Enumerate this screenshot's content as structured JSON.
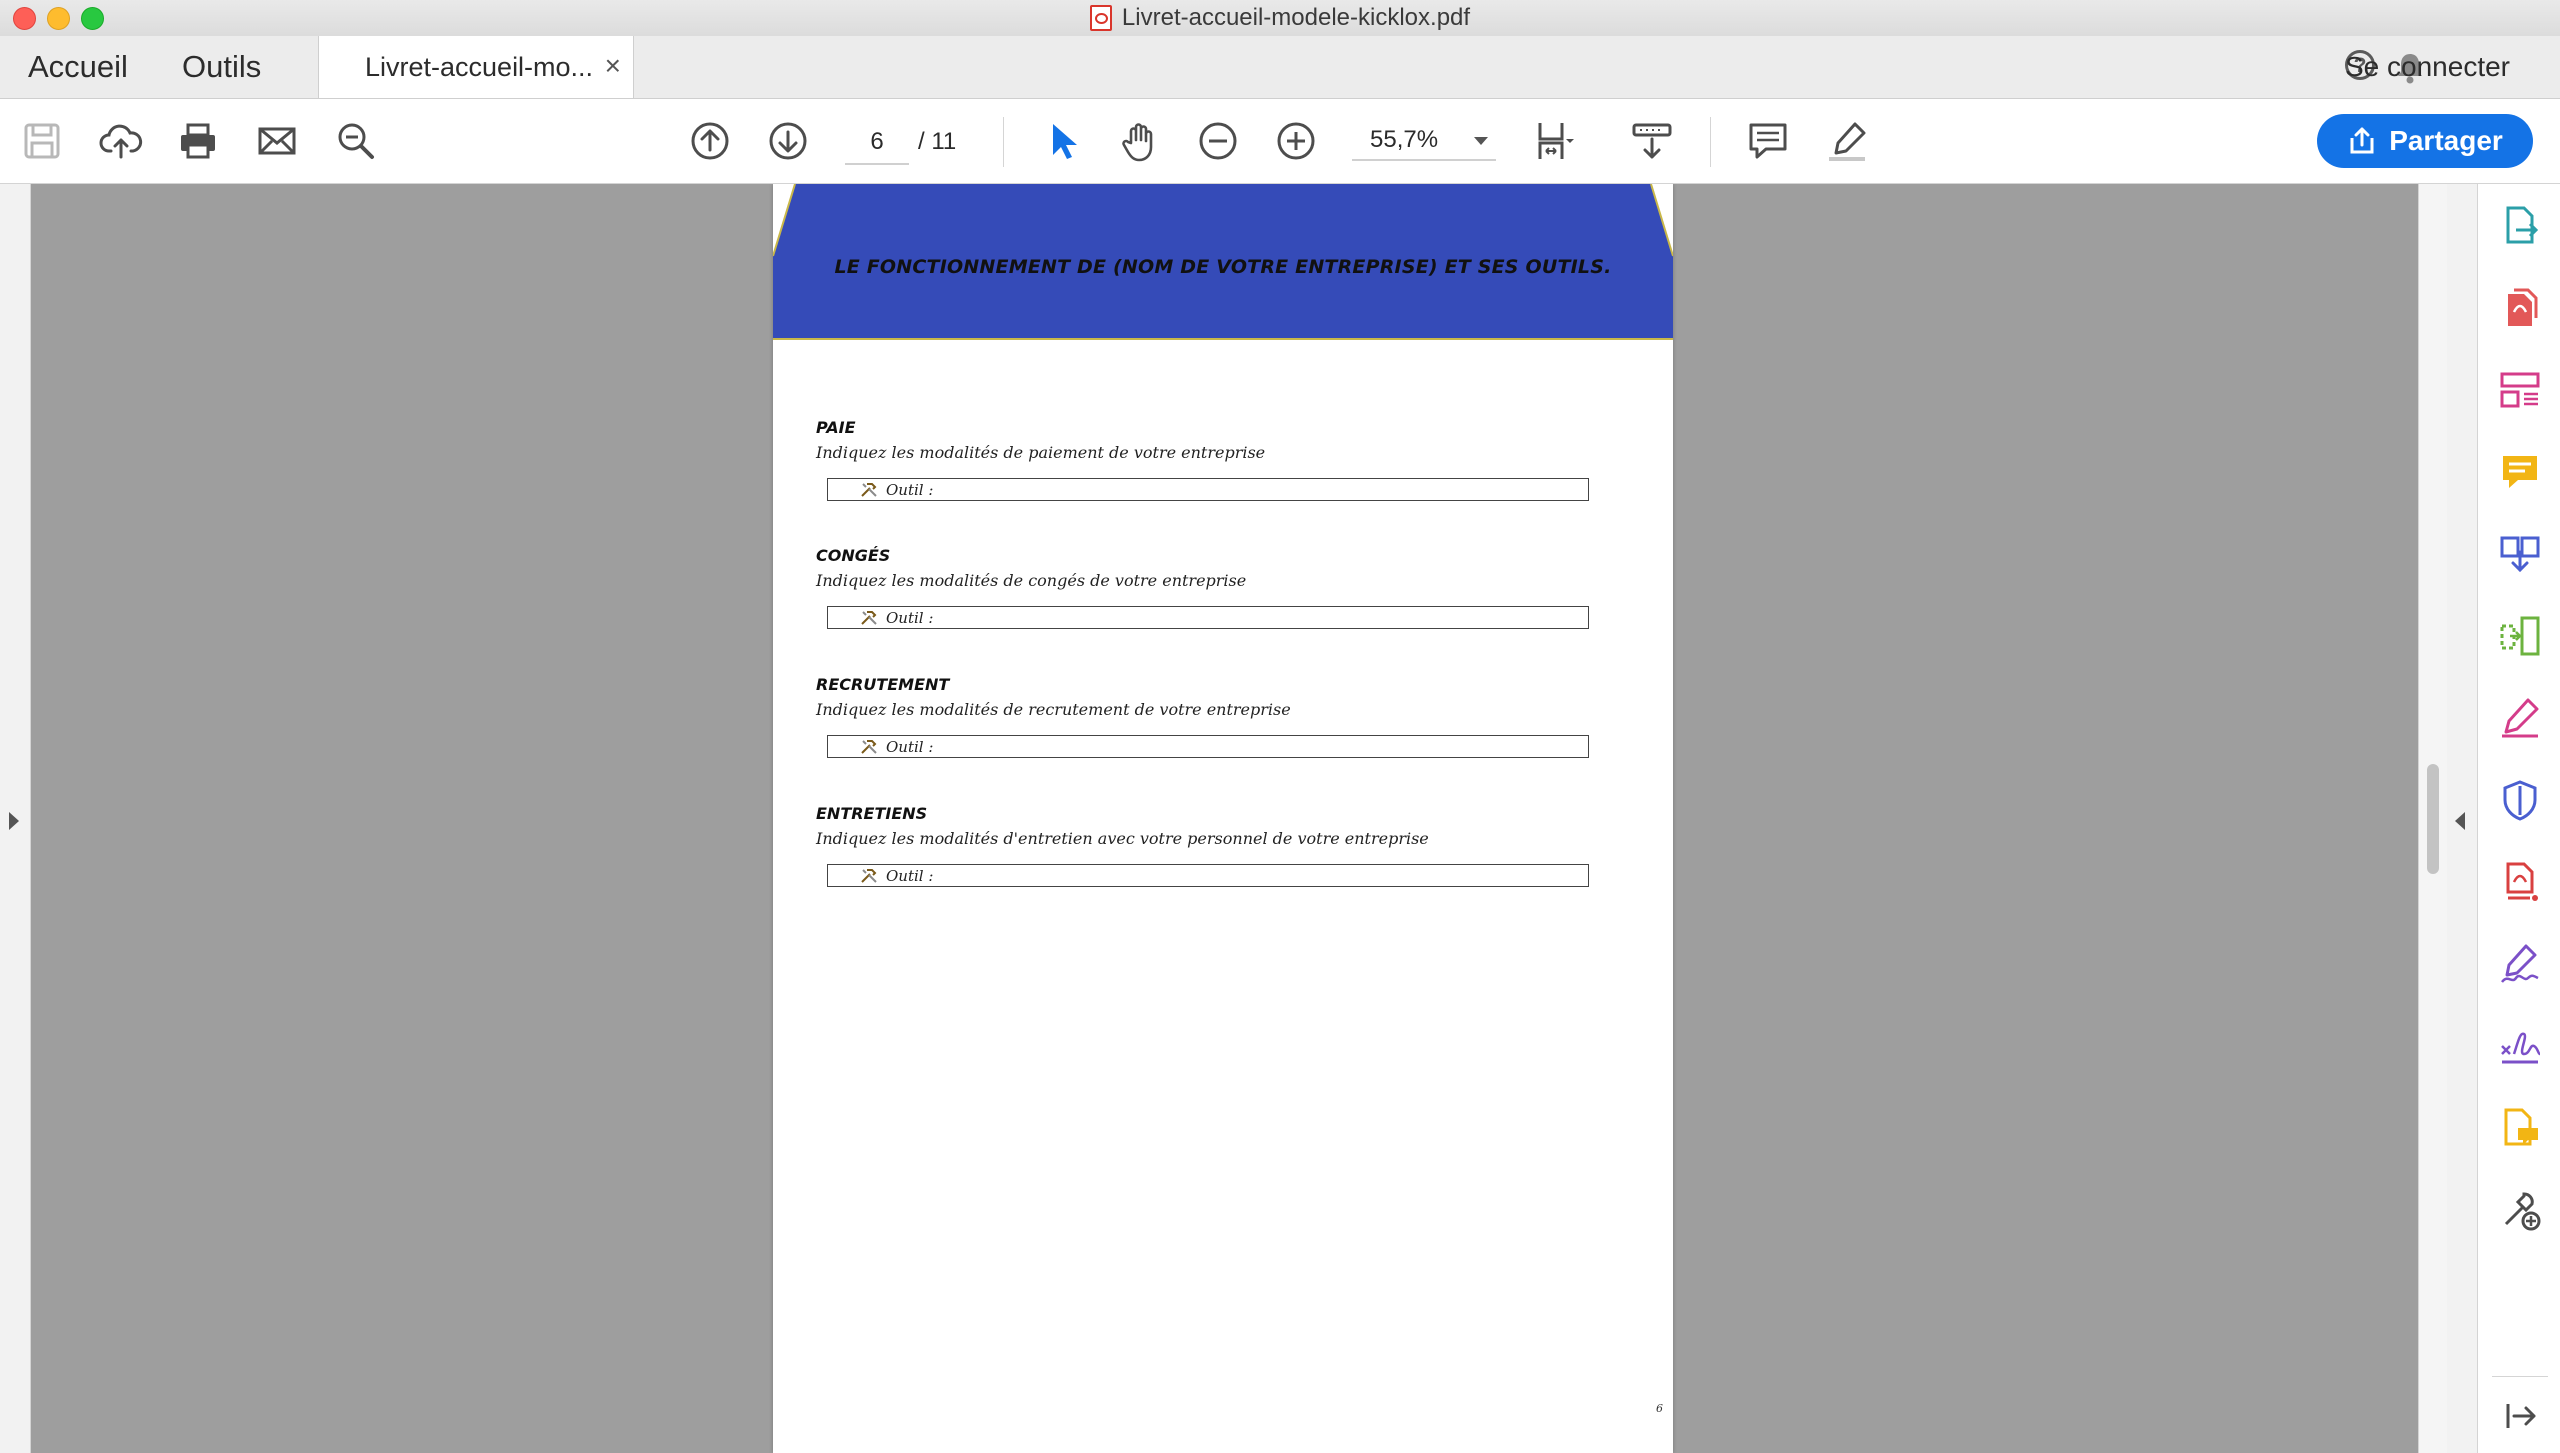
{
  "window": {
    "title": "Livret-accueil-modele-kicklox.pdf"
  },
  "tabs": {
    "home": "Accueil",
    "tools": "Outils",
    "document": "Livret-accueil-mo...",
    "close": "×"
  },
  "header_right": {
    "signin": "Se connecter",
    "help": "?"
  },
  "toolbar": {
    "page_current": "6",
    "page_total": "/ 11",
    "zoom": "55,7%",
    "share_label": "Partager",
    "icons": [
      "save-icon",
      "cloud-upload-icon",
      "print-icon",
      "mail-icon",
      "search-zoom-icon",
      "page-up-icon",
      "page-down-icon",
      "select-pointer-icon",
      "hand-icon",
      "zoom-out-icon",
      "zoom-in-icon",
      "page-fit-icon",
      "scroll-mode-icon",
      "comment-icon",
      "highlight-pen-icon"
    ]
  },
  "colors": {
    "accent": "#1473e6",
    "banner": "#354bb8",
    "viewer_bg": "#9e9e9e"
  },
  "document": {
    "banner_title": "LE FONCTIONNEMENT DE (NOM DE VOTRE ENTREPRISE) ET SES OUTILS.",
    "tool_label": "Outil :",
    "page_number": "6",
    "sections": [
      {
        "title": "PAIE",
        "desc": "Indiquez les modalités de paiement de votre entreprise"
      },
      {
        "title": "CONGÉS",
        "desc": "Indiquez les modalités de congés de votre entreprise"
      },
      {
        "title": "RECRUTEMENT",
        "desc": "Indiquez les modalités de recrutement de votre entreprise"
      },
      {
        "title": "ENTRETIENS",
        "desc": "Indiquez les modalités d'entretien avec votre personnel de votre entreprise"
      }
    ]
  },
  "right_panel_icons": [
    "export-pdf-icon",
    "create-pdf-icon",
    "organize-pages-icon",
    "comment-tool-icon",
    "combine-files-icon",
    "compress-icon",
    "fill-sign-icon",
    "protect-icon",
    "pdf-edit-icon",
    "request-signature-icon",
    "certificate-sign-icon",
    "send-review-icon",
    "more-tools-icon",
    "collapse-panel-icon"
  ]
}
